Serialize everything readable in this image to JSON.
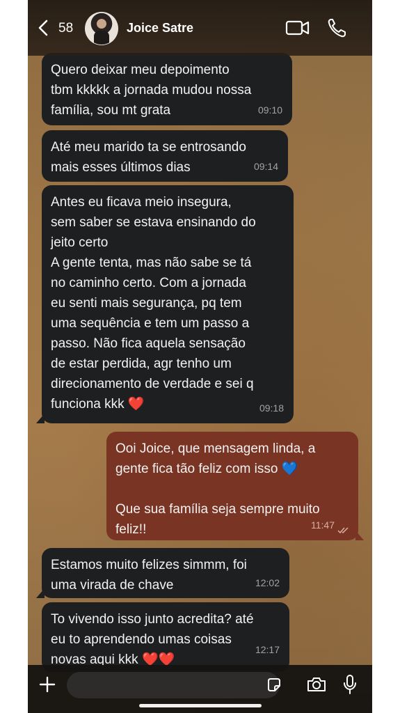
{
  "header": {
    "back_count": "58",
    "contact_name": "Joice Satre"
  },
  "messages": [
    {
      "direction": "in",
      "text": "Quero deixar meu depoimento\ntbm kkkkk a jornada mudou nossa\nfamília, sou mt grata",
      "time": "09:10"
    },
    {
      "direction": "in",
      "text": "Até meu marido ta se entrosando\nmais esses últimos dias",
      "time": "09:14"
    },
    {
      "direction": "in",
      "text": "Antes eu ficava meio insegura,\nsem saber se estava ensinando do\njeito certo\nA gente tenta, mas não sabe se tá\nno caminho certo. Com a jornada\neu senti mais segurança, pq tem\numa sequência e tem um passo a\npasso. Não fica aquela sensação\nde estar perdida, agr tenho um\ndirecionamento de verdade e sei q\nfunciona kkk ❤️",
      "time": "09:18"
    },
    {
      "direction": "out",
      "text": "Ooi Joice, que mensagem linda, a\ngente fica tão feliz com isso 💙\n\nQue sua família seja sempre muito\nfeliz!!",
      "time": "11:47",
      "status": "read"
    },
    {
      "direction": "in",
      "text": "Estamos muito felizes simmm, foi\numa virada de chave",
      "time": "12:02"
    },
    {
      "direction": "in",
      "text": "To vivendo isso junto acredita? até\neu to aprendendo umas coisas\nnovas aqui kkk ❤️❤️",
      "time": "12:17"
    }
  ],
  "composer": {
    "input_value": ""
  },
  "icons": {
    "back": "chevron-left-icon",
    "video": "video-camera-icon",
    "phone": "phone-icon",
    "plus": "plus-icon",
    "sticker": "sticker-icon",
    "camera": "camera-icon",
    "mic": "microphone-icon"
  },
  "colors": {
    "incoming_bubble": "#1e1f21",
    "outgoing_bubble": "#7a3424",
    "header_bg": "#1e1812"
  }
}
